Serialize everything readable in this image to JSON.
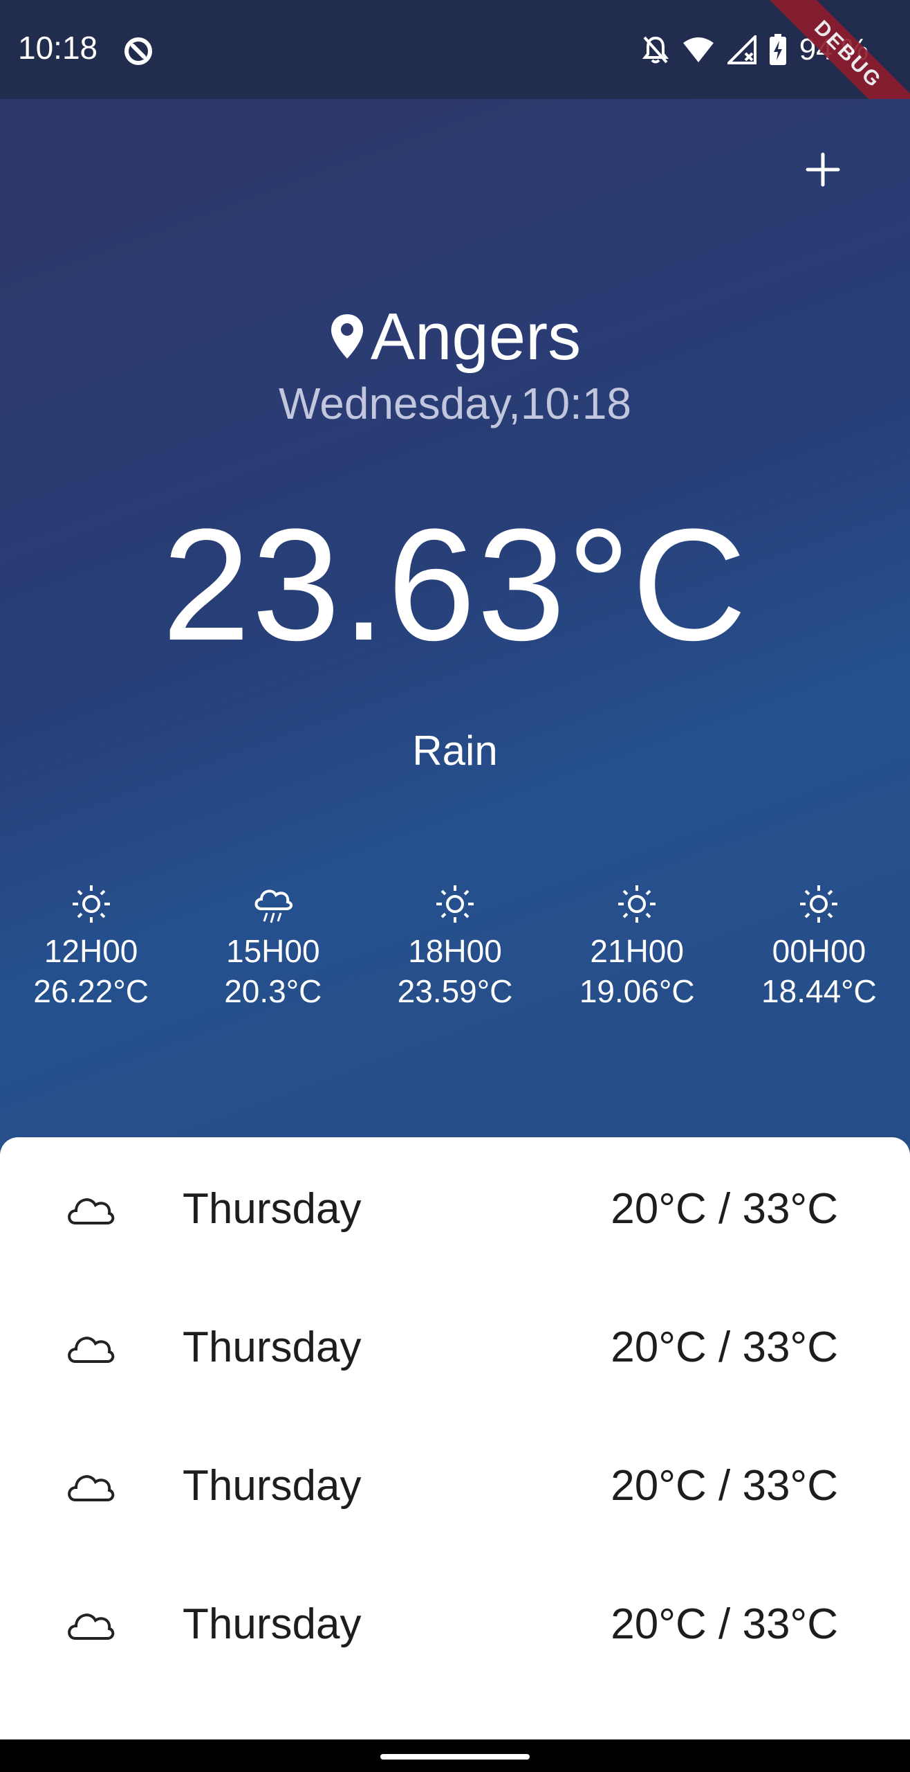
{
  "status_bar": {
    "time": "10:18",
    "battery_percent": "94 %",
    "icons": [
      "app-notification-icon",
      "bell-off-icon",
      "wifi-icon",
      "signal-off-icon",
      "battery-charging-icon"
    ]
  },
  "debug_banner": "DEBUG",
  "header": {
    "add_icon": "plus-icon",
    "city": "Angers",
    "location_icon": "map-pin-icon",
    "date_time": "Wednesday,10:18",
    "temperature": "23.63°C",
    "condition": "Rain"
  },
  "hourly": [
    {
      "time": "12H00",
      "temp": "26.22°C",
      "icon": "sun-icon"
    },
    {
      "time": "15H00",
      "temp": "20.3°C",
      "icon": "rain-cloud-icon"
    },
    {
      "time": "18H00",
      "temp": "23.59°C",
      "icon": "sun-icon"
    },
    {
      "time": "21H00",
      "temp": "19.06°C",
      "icon": "sun-icon"
    },
    {
      "time": "00H00",
      "temp": "18.44°C",
      "icon": "sun-icon"
    }
  ],
  "daily": [
    {
      "day": "Thursday",
      "range": "20°C / 33°C",
      "icon": "cloud-icon"
    },
    {
      "day": "Thursday",
      "range": "20°C / 33°C",
      "icon": "cloud-icon"
    },
    {
      "day": "Thursday",
      "range": "20°C / 33°C",
      "icon": "cloud-icon"
    },
    {
      "day": "Thursday",
      "range": "20°C / 33°C",
      "icon": "cloud-icon"
    }
  ],
  "colors": {
    "status_bar_bg": "#222c4f",
    "hero_gradient_start": "#2d3668",
    "hero_gradient_end": "#25508e",
    "sheet_bg": "#ffffff",
    "debug_ribbon": "#8e1c2c"
  }
}
